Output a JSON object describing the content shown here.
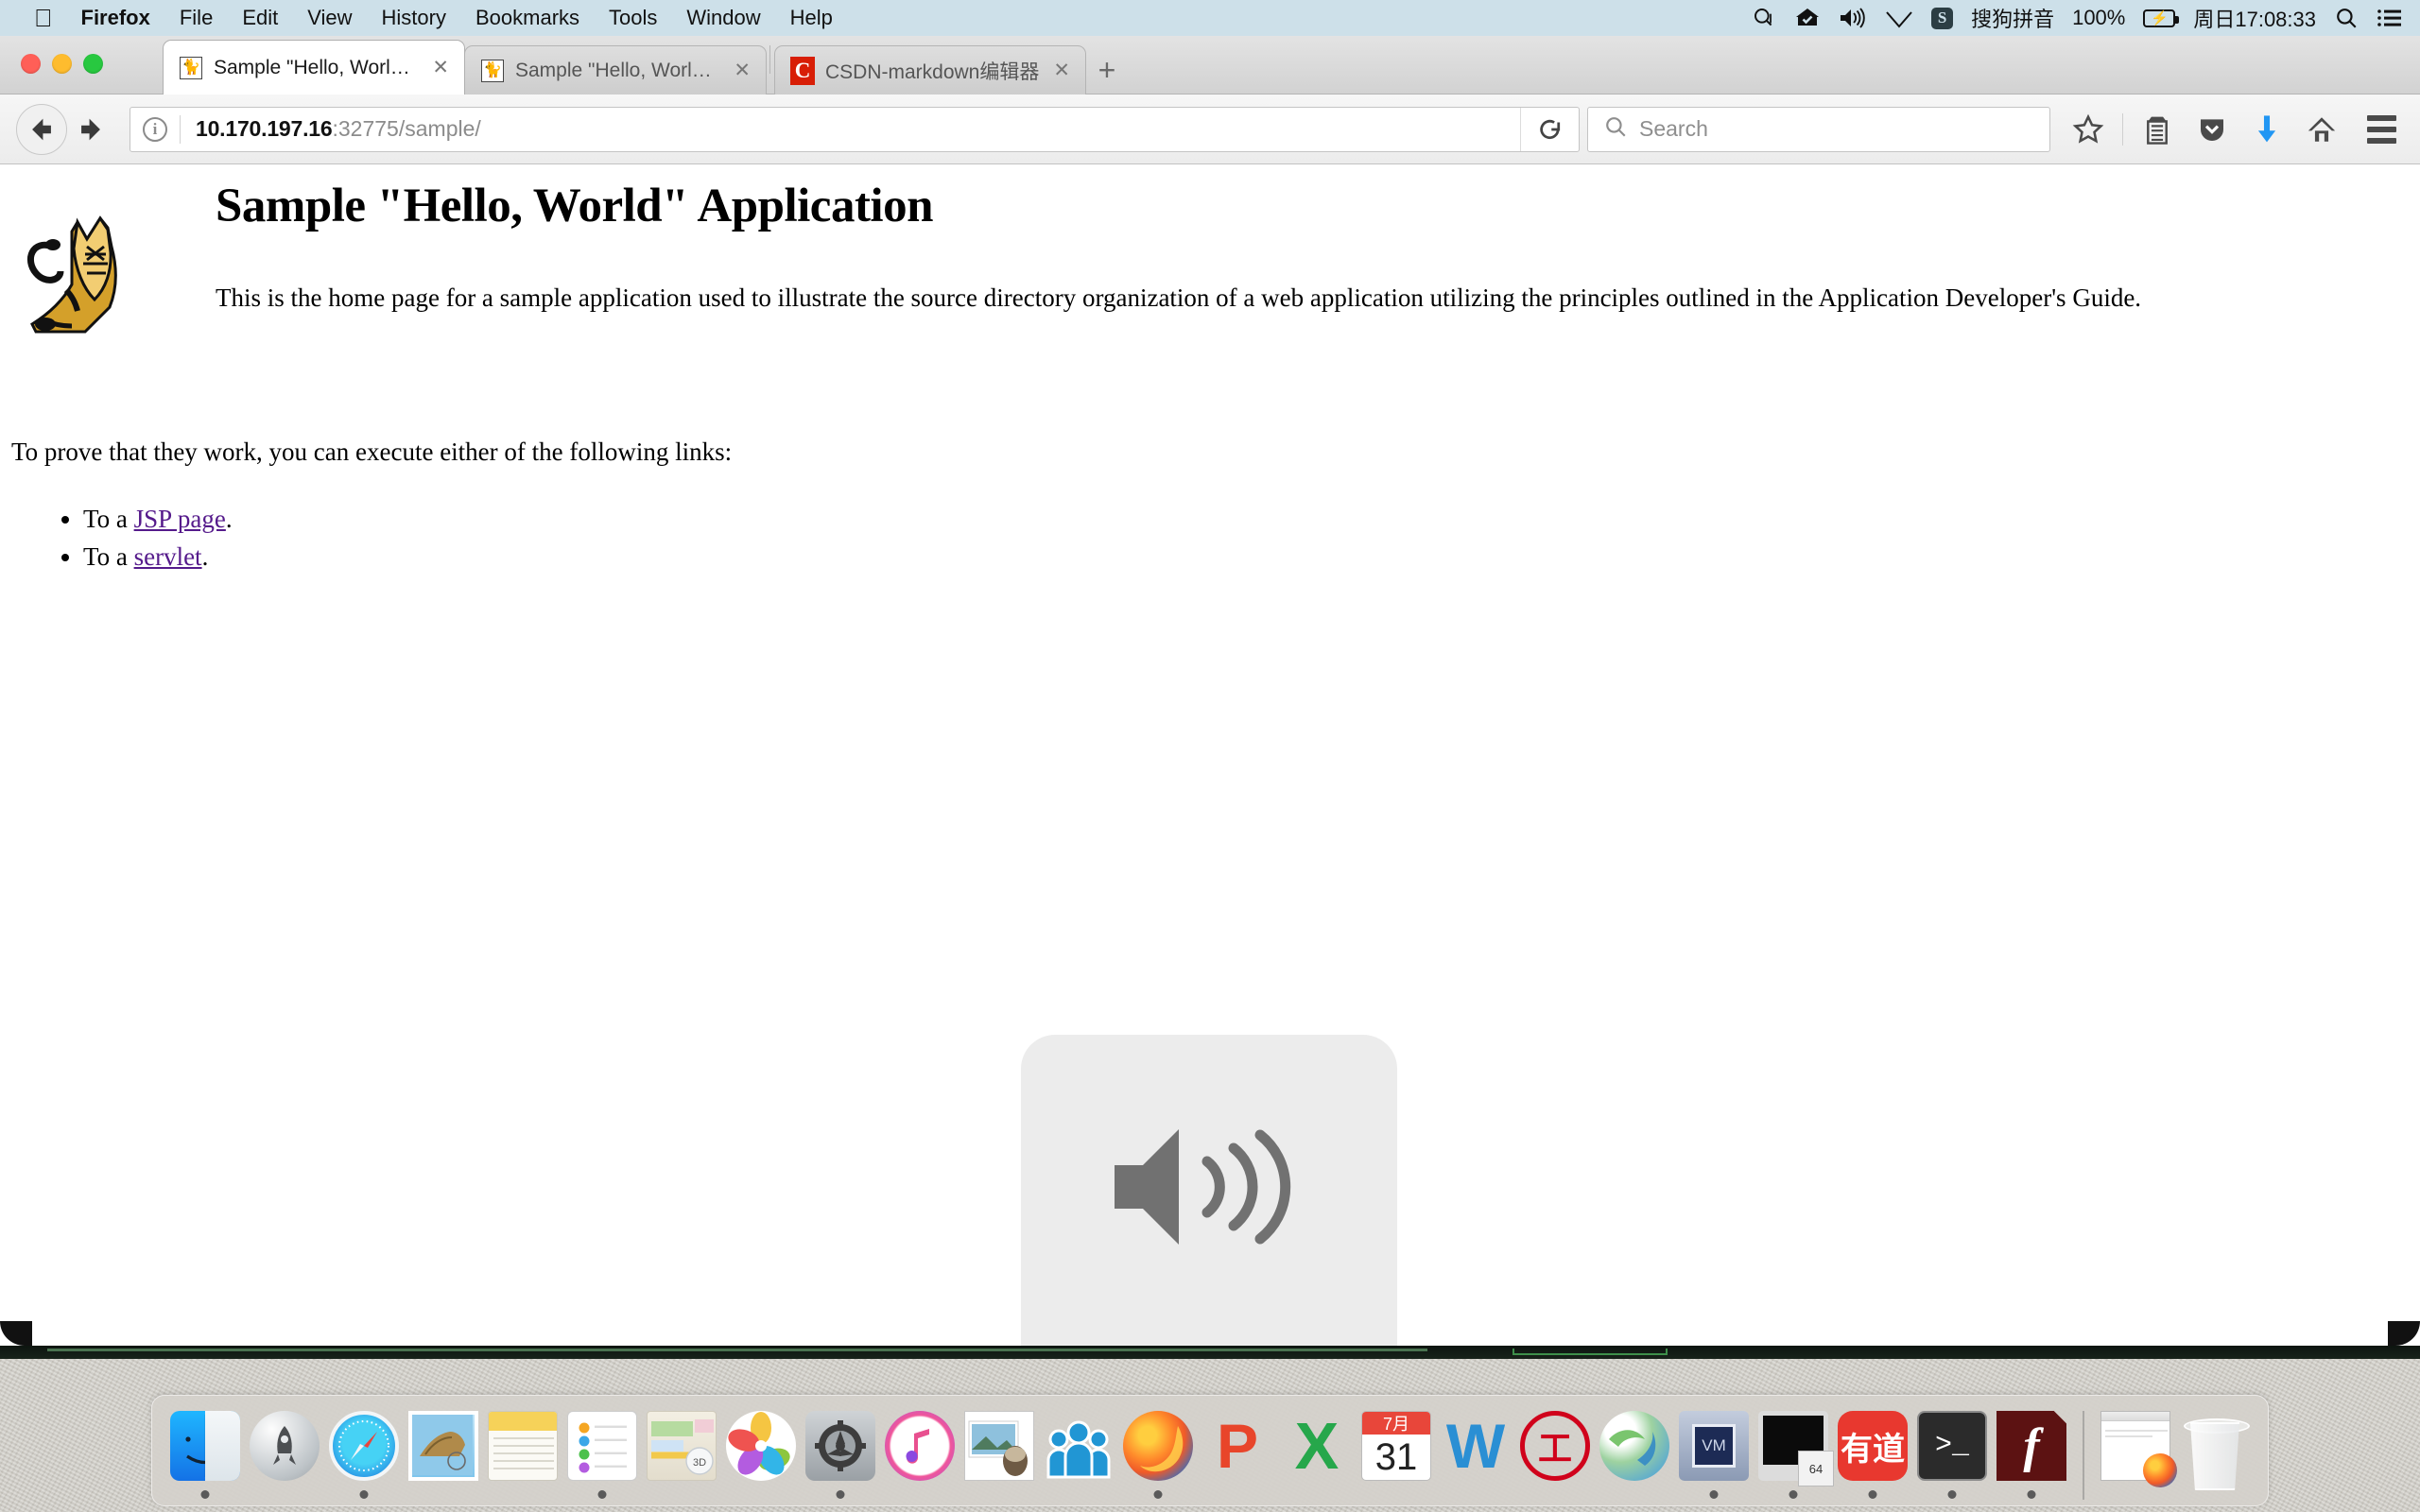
{
  "menubar": {
    "apple_glyph": "&#63743;",
    "items": [
      {
        "label": "Firefox",
        "bold": true
      },
      {
        "label": "File",
        "bold": false
      },
      {
        "label": "Edit",
        "bold": false
      },
      {
        "label": "View",
        "bold": false
      },
      {
        "label": "History",
        "bold": false
      },
      {
        "label": "Bookmarks",
        "bold": false
      },
      {
        "label": "Tools",
        "bold": false
      },
      {
        "label": "Window",
        "bold": false
      },
      {
        "label": "Help",
        "bold": false
      }
    ],
    "status": {
      "spotlight_icon": "search-magnifier-icon",
      "dropbox_icon": "dropbox-check-icon",
      "volume_icon": "volume-icon",
      "wifi_icon": "wifi-icon",
      "ime_badge": "S",
      "ime_label": "搜狗拼音",
      "battery_percent": "100%",
      "battery_icon": "battery-charging-icon",
      "clock": "周日17:08:33",
      "search_icon": "spotlight-search-icon",
      "notifications_icon": "notification-center-icon"
    },
    "bg_color": "#cde0e9"
  },
  "window": {
    "traffic_lights": {
      "close": "#ff5f57",
      "minimize": "#febc2e",
      "maximize": "#28c840"
    },
    "tabs": [
      {
        "favicon": "tomcat-favicon",
        "title": "Sample \"Hello, World\" Appl...",
        "active": true,
        "close_label": "✕"
      },
      {
        "favicon": "tomcat-favicon",
        "title": "Sample \"Hello, World\" Appl...",
        "active": false,
        "close_label": "✕"
      },
      {
        "favicon": "csdn-favicon",
        "title": "CSDN-markdown编辑器",
        "active": false,
        "close_label": "✕"
      }
    ],
    "new_tab_label": "+"
  },
  "navbar": {
    "back_glyph": "⬅",
    "forward_glyph": "➡",
    "identity_glyph": "i",
    "url_host": "10.170.197.16",
    "url_rest": ":32775/sample/",
    "reload_glyph": "⟳",
    "search_placeholder": "Search",
    "icons": [
      {
        "name": "bookmark-star-icon",
        "glyph": "☆"
      },
      {
        "name": "library-icon",
        "glyph": "▤"
      },
      {
        "name": "pocket-icon",
        "glyph": "▽"
      },
      {
        "name": "downloads-icon",
        "glyph": "⬇",
        "color": "#2196f3"
      },
      {
        "name": "home-icon",
        "glyph": "⌂"
      }
    ],
    "menu_icon": "hamburger-menu-icon"
  },
  "page": {
    "logo_alt": "tomcat-cat-logo",
    "title": "Sample \"Hello, World\" Application",
    "intro": "This is the home page for a sample application used to illustrate the source directory organization of a web application utilizing the principles outlined in the Application Developer's Guide.",
    "prove": "To prove that they work, you can execute either of the following links:",
    "links": [
      {
        "prefix": "To a ",
        "link_text": "JSP page",
        "suffix": "."
      },
      {
        "prefix": "To a ",
        "link_text": "servlet",
        "suffix": "."
      }
    ],
    "link_color": "#551a8b"
  },
  "volume_osd": {
    "icon": "speaker-waves-icon",
    "segments_total": 16,
    "segments_filled": 0,
    "bg_color": "#ececec",
    "fg_color": "#6e6e6e"
  },
  "dock": {
    "items": [
      {
        "name": "finder",
        "icon": "finder-icon",
        "running": true
      },
      {
        "name": "launchpad",
        "icon": "launchpad-icon",
        "running": false
      },
      {
        "name": "safari",
        "icon": "safari-icon",
        "running": true
      },
      {
        "name": "mail",
        "icon": "mail-icon",
        "running": false
      },
      {
        "name": "notes",
        "icon": "notes-icon",
        "running": false
      },
      {
        "name": "reminders",
        "icon": "reminders-icon",
        "running": true
      },
      {
        "name": "maps",
        "icon": "maps-icon",
        "running": false
      },
      {
        "name": "photos",
        "icon": "photos-icon",
        "running": false
      },
      {
        "name": "system-preferences",
        "icon": "gear-icon",
        "running": true
      },
      {
        "name": "itunes",
        "icon": "itunes-note-icon",
        "running": false
      },
      {
        "name": "preview",
        "icon": "preview-icon",
        "running": false
      },
      {
        "name": "contacts",
        "icon": "contacts-icon",
        "running": false
      },
      {
        "name": "firefox",
        "icon": "firefox-icon",
        "running": true
      },
      {
        "name": "pdf-reader",
        "icon": "pdf-p-icon",
        "running": false
      },
      {
        "name": "excel",
        "icon": "excel-x-icon",
        "running": false
      },
      {
        "name": "calendar",
        "icon": "calendar-icon",
        "running": false
      },
      {
        "name": "word",
        "icon": "word-w-icon",
        "running": false
      },
      {
        "name": "icbc-bank",
        "icon": "icbc-icon",
        "running": false
      },
      {
        "name": "sphere-app",
        "icon": "sphere-icon",
        "running": false
      },
      {
        "name": "virtualbox",
        "icon": "virtualbox-icon",
        "running": true
      },
      {
        "name": "display-app",
        "icon": "display-icon",
        "running": true
      },
      {
        "name": "youdao-dict",
        "icon": "youdao-icon",
        "running": true
      },
      {
        "name": "terminal",
        "icon": "terminal-icon",
        "running": true
      },
      {
        "name": "flash-player",
        "icon": "flash-icon",
        "running": true
      }
    ],
    "minimized": {
      "name": "firefox-window",
      "icon": "minimized-window-icon"
    },
    "trash": {
      "name": "trash",
      "icon": "trash-icon"
    },
    "calendar_month": "7月",
    "calendar_day": "31",
    "excel_glyph": "X",
    "word_glyph": "W",
    "pdf_glyph": "P",
    "icbc_glyph": "工",
    "youdao_glyph": "有道",
    "terminal_glyph": ">_",
    "flash_glyph": "f",
    "vbox_glyph": "VM",
    "display_badge": "64"
  }
}
